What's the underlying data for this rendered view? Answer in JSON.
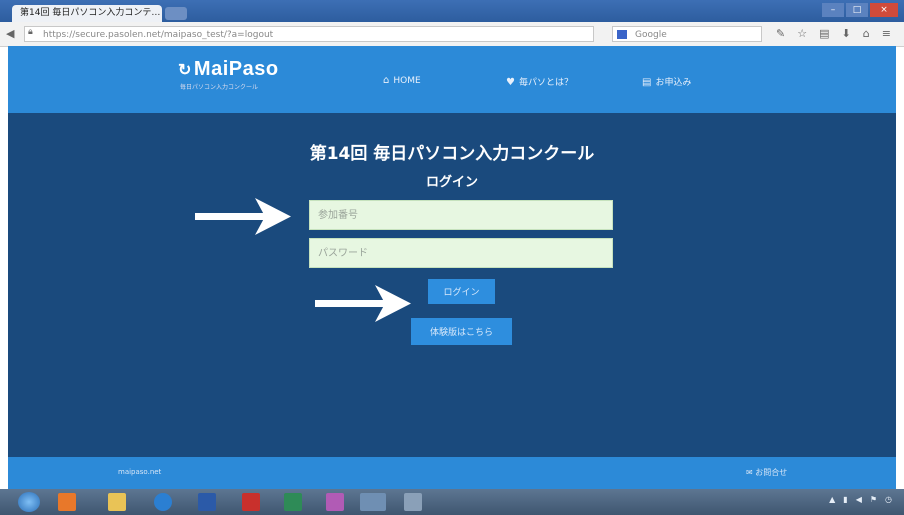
{
  "browser": {
    "tab_title": "第14回 毎日パソコン入力コンテ…",
    "url": "https://secure.pasolen.net/maipaso_test/?a=logout",
    "search_placeholder": "Google",
    "window_buttons": [
      "–",
      "□",
      "×"
    ]
  },
  "site": {
    "logo_text": "MaiPaso",
    "logo_sub": "毎日パソコン入力コンクール",
    "nav": {
      "home": "HOME",
      "about": "毎パソとは？",
      "apply": "お申込み"
    }
  },
  "main": {
    "title": "第14回 毎日パソコン入力コンクール",
    "login_heading": "ログイン",
    "id_placeholder": "参加番号",
    "password_placeholder": "パスワード",
    "login_button": "ログイン",
    "trial_button": "体験版はこちら"
  },
  "footer": {
    "left": "maipaso.net",
    "right": "お問合せ"
  },
  "colors": {
    "header_blue": "#2c8ad8",
    "main_navy": "#1a4a7d",
    "input_bg": "#e7f7e1",
    "button_blue": "#2e8ede",
    "arrow": "#ffffff"
  }
}
